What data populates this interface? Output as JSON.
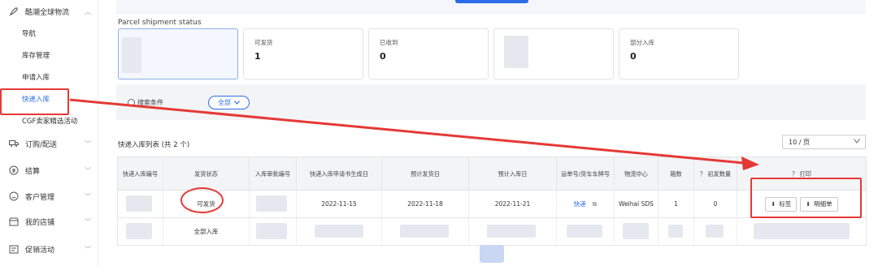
{
  "sidebar": {
    "top_group": {
      "label": "酷潮全球物流",
      "icon": "rocket-icon"
    },
    "sub_items": [
      {
        "label": "导航",
        "active": false
      },
      {
        "label": "库存管理",
        "active": false
      },
      {
        "label": "申请入库",
        "active": false
      },
      {
        "label": "快递入库",
        "active": true
      },
      {
        "label": "CGF卖家精选活动",
        "active": false
      }
    ],
    "groups": [
      {
        "label": "订购/配送",
        "icon": "truck-icon"
      },
      {
        "label": "结算",
        "icon": "wallet-icon"
      },
      {
        "label": "客户管理",
        "icon": "smile-icon"
      },
      {
        "label": "我的店铺",
        "icon": "store-icon"
      },
      {
        "label": "促销活动",
        "icon": "promo-icon"
      }
    ]
  },
  "status": {
    "title": "Parcel shipment status",
    "cards": [
      {
        "label": "",
        "value": ""
      },
      {
        "label": "可发货",
        "value": "1"
      },
      {
        "label": "已收到",
        "value": "0"
      },
      {
        "label": "",
        "value": ""
      },
      {
        "label": "部分入库",
        "value": "0"
      }
    ]
  },
  "search": {
    "label": "搜索条件",
    "pill": "全部"
  },
  "list": {
    "title": "快递入库列表 (共 2 个)",
    "page_size": "10 / 页"
  },
  "table": {
    "headers": [
      "快递入库编号",
      "发货状态",
      "入库审批编号",
      "快递入库申请书生成日",
      "预计发货日",
      "预计入库日",
      "运单号/货车车牌号",
      "物流中心",
      "箱数",
      "？ 初发数量",
      "？ 打印"
    ],
    "rows": [
      {
        "status": "可发货",
        "created": "2022-11-15",
        "ship_date": "2022-11-18",
        "arrive_date": "2022-11-21",
        "waybill": "快递",
        "center": "Weihai SDS",
        "boxes": "1",
        "qty": "0",
        "print_label": "标签",
        "print_detail": "明细单"
      },
      {
        "status": "全部入库"
      }
    ]
  },
  "colors": {
    "accent": "#2b6de8",
    "annotation": "#e53935"
  }
}
